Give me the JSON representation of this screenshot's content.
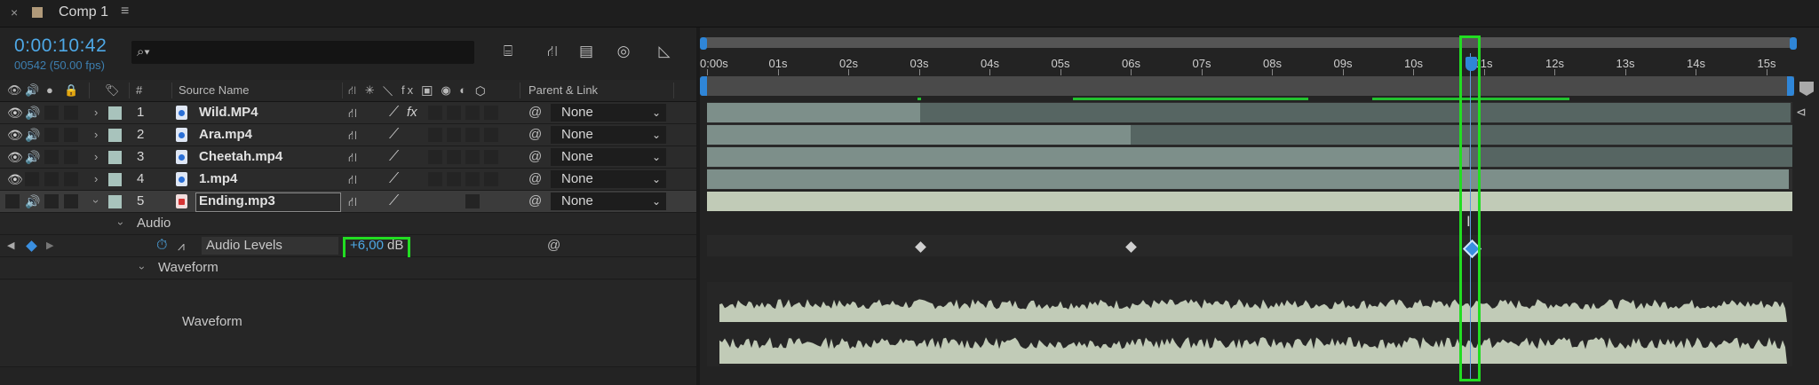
{
  "tab": {
    "close": "×",
    "title": "Comp 1",
    "menu": "≡"
  },
  "comp": {
    "timecode": "0:00:10:42",
    "frames": "00542 (50.00 fps)"
  },
  "search": {
    "icon": "search-icon",
    "glyph": "⌕▾"
  },
  "columns": {
    "hash": "#",
    "source_name": "Source Name",
    "parent_link": "Parent & Link"
  },
  "switch_header_glyphs": "⛙ ✳ ⟍ fx ▣ ◉ ◐ ⬡",
  "layers": [
    {
      "num": "1",
      "name": "Wild.MP4",
      "parent": "None",
      "type": "video"
    },
    {
      "num": "2",
      "name": "Ara.mp4",
      "parent": "None",
      "type": "video"
    },
    {
      "num": "3",
      "name": "Cheetah.mp4",
      "parent": "None",
      "type": "video"
    },
    {
      "num": "4",
      "name": "1.mp4",
      "parent": "None",
      "type": "video"
    },
    {
      "num": "5",
      "name": "Ending.mp3",
      "parent": "None",
      "type": "audio"
    }
  ],
  "audio": {
    "group": "Audio",
    "property": "Audio Levels",
    "value": "+6,00",
    "unit": "dB",
    "waveform_group": "Waveform",
    "waveform_label": "Waveform"
  },
  "ruler": [
    "0:00s",
    "01s",
    "02s",
    "03s",
    "04s",
    "05s",
    "06s",
    "07s",
    "08s",
    "09s",
    "10s",
    "11s",
    "12s",
    "13s",
    "14s",
    "15s"
  ],
  "playhead_seconds": 10.84,
  "accent": "#2f86d8",
  "highlight": "#22dd22"
}
